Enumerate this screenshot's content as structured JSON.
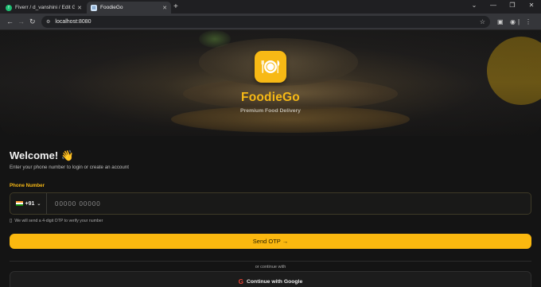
{
  "browser": {
    "tabs": [
      {
        "label": "Fiverr / d_vanshini / Edit Gig",
        "favicon": "fiverr-icon",
        "active": false
      },
      {
        "label": "FoodieGo",
        "favicon": "site-icon",
        "active": true
      }
    ],
    "new_tab": "+",
    "url": "localhost:8080",
    "window_buttons": [
      "⌄",
      "—",
      "❐",
      "✕"
    ]
  },
  "hero": {
    "brand": "FoodieGo",
    "tagline": "Premium Food Delivery",
    "logo_icon": "plate-cutlery-icon"
  },
  "login": {
    "welcome": "Welcome! 👋",
    "subtitle": "Enter your phone number to login or create an account",
    "phone_label": "Phone Number",
    "country_code": "+91",
    "country_flag": "india-flag-icon",
    "phone_placeholder": "00000 00000",
    "phone_value": "",
    "hint": "We will send a 4-digit OTP to verify your number",
    "send_button": "Send OTP  →",
    "or_text": "or continue with",
    "google_button": "Continue with Google"
  },
  "colors": {
    "accent": "#f7b915",
    "background": "#141414"
  }
}
